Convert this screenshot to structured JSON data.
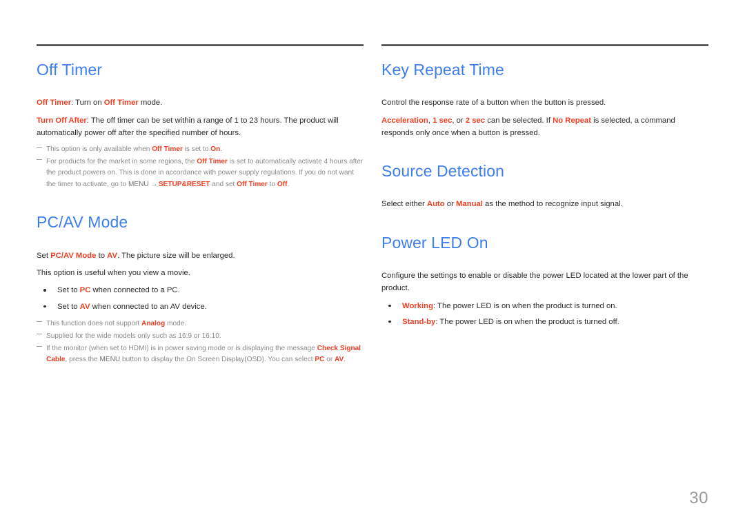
{
  "page": {
    "number": "30",
    "background_color": "#ffffff",
    "heading_color": "#3d7eed",
    "highlight_color": "#ef3e23",
    "body_color": "#2b2b2b",
    "note_color": "#8a8a8a",
    "rule_color": "#555555"
  },
  "left_column": {
    "sections": [
      {
        "title": "Off Timer",
        "paragraphs": [
          {
            "parts": [
              {
                "text": "Off Timer",
                "style": "highlight"
              },
              {
                "text": ": Turn on ",
                "style": "plain"
              },
              {
                "text": "Off Timer",
                "style": "highlight"
              },
              {
                "text": " mode.",
                "style": "plain"
              }
            ]
          },
          {
            "parts": [
              {
                "text": "Turn Off After",
                "style": "highlight"
              },
              {
                "text": ": The off timer can be set within a range of 1 to 23 hours. The product will automatically power off after the specified number of hours.",
                "style": "plain"
              }
            ]
          }
        ],
        "bullets": [],
        "notes": [
          {
            "parts": [
              {
                "text": "This option is only available when ",
                "style": "plain"
              },
              {
                "text": "Off Timer",
                "style": "highlight"
              },
              {
                "text": " is set to ",
                "style": "plain"
              },
              {
                "text": "On",
                "style": "highlight"
              },
              {
                "text": ".",
                "style": "plain"
              }
            ]
          },
          {
            "parts": [
              {
                "text": "For products for the market in some regions, the ",
                "style": "plain"
              },
              {
                "text": "Off Timer",
                "style": "highlight"
              },
              {
                "text": " is set to automatically activate 4 hours after the product powers on. This is done in accordance with power supply regulations. If you do not want the timer to activate, go to ",
                "style": "plain"
              },
              {
                "text": "MENU",
                "style": "caps"
              },
              {
                "text": " → ",
                "style": "arrow"
              },
              {
                "text": "SETUP&RESET",
                "style": "highlight"
              },
              {
                "text": " and set ",
                "style": "plain"
              },
              {
                "text": "Off Timer",
                "style": "highlight"
              },
              {
                "text": " to ",
                "style": "plain"
              },
              {
                "text": "Off",
                "style": "highlight"
              },
              {
                "text": ".",
                "style": "plain"
              }
            ]
          }
        ]
      },
      {
        "title": "PC/AV Mode",
        "paragraphs": [
          {
            "parts": [
              {
                "text": "Set ",
                "style": "plain"
              },
              {
                "text": "PC/AV Mode",
                "style": "highlight"
              },
              {
                "text": " to ",
                "style": "plain"
              },
              {
                "text": "AV",
                "style": "highlight"
              },
              {
                "text": ". The picture size will be enlarged.",
                "style": "plain"
              }
            ]
          },
          {
            "parts": [
              {
                "text": "This option is useful when you view a movie.",
                "style": "plain"
              }
            ]
          }
        ],
        "bullets": [
          {
            "parts": [
              {
                "text": "Set to ",
                "style": "plain"
              },
              {
                "text": "PC",
                "style": "highlight"
              },
              {
                "text": " when connected to a PC.",
                "style": "plain"
              }
            ]
          },
          {
            "parts": [
              {
                "text": "Set to ",
                "style": "plain"
              },
              {
                "text": "AV",
                "style": "highlight"
              },
              {
                "text": " when connected to an AV device.",
                "style": "plain"
              }
            ]
          }
        ],
        "notes": [
          {
            "parts": [
              {
                "text": "This function does not support ",
                "style": "plain"
              },
              {
                "text": "Analog",
                "style": "highlight"
              },
              {
                "text": " mode.",
                "style": "plain"
              }
            ]
          },
          {
            "parts": [
              {
                "text": "Supplied for the wide models only such as 16:9 or 16:10.",
                "style": "plain"
              }
            ]
          },
          {
            "parts": [
              {
                "text": "If the monitor (when set to HDMI) is in power saving mode or is displaying the message ",
                "style": "plain"
              },
              {
                "text": "Check Signal Cable",
                "style": "highlight"
              },
              {
                "text": ", press the ",
                "style": "plain"
              },
              {
                "text": "MENU",
                "style": "caps"
              },
              {
                "text": " button to display the On Screen Display(OSD). You can select ",
                "style": "plain"
              },
              {
                "text": "PC",
                "style": "highlight"
              },
              {
                "text": " or ",
                "style": "plain"
              },
              {
                "text": "AV",
                "style": "highlight"
              },
              {
                "text": ".",
                "style": "plain"
              }
            ]
          }
        ]
      }
    ]
  },
  "right_column": {
    "sections": [
      {
        "title": "Key Repeat Time",
        "paragraphs": [
          {
            "parts": [
              {
                "text": "Control the response rate of a button when the button is pressed.",
                "style": "plain"
              }
            ]
          },
          {
            "parts": [
              {
                "text": "Acceleration",
                "style": "highlight"
              },
              {
                "text": ", ",
                "style": "plain"
              },
              {
                "text": "1 sec",
                "style": "highlight"
              },
              {
                "text": ", or ",
                "style": "plain"
              },
              {
                "text": "2 sec",
                "style": "highlight"
              },
              {
                "text": " can be selected. If ",
                "style": "plain"
              },
              {
                "text": "No Repeat",
                "style": "highlight"
              },
              {
                "text": " is selected, a command responds only once when a button is pressed.",
                "style": "plain"
              }
            ]
          }
        ],
        "bullets": [],
        "notes": []
      },
      {
        "title": "Source Detection",
        "paragraphs": [
          {
            "parts": [
              {
                "text": "Select either ",
                "style": "plain"
              },
              {
                "text": "Auto",
                "style": "highlight"
              },
              {
                "text": " or ",
                "style": "plain"
              },
              {
                "text": "Manual",
                "style": "highlight"
              },
              {
                "text": " as the method to recognize input signal.",
                "style": "plain"
              }
            ]
          }
        ],
        "bullets": [],
        "notes": []
      },
      {
        "title": "Power LED On",
        "paragraphs": [
          {
            "parts": [
              {
                "text": "Configure the settings to enable or disable the power LED located at the lower part of the product.",
                "style": "plain"
              }
            ]
          }
        ],
        "bullets": [
          {
            "parts": [
              {
                "text": "Working",
                "style": "highlight"
              },
              {
                "text": ": The power LED is on when the product is turned on.",
                "style": "plain"
              }
            ]
          },
          {
            "parts": [
              {
                "text": "Stand-by",
                "style": "highlight"
              },
              {
                "text": ": The power LED is on when the product is turned off.",
                "style": "plain"
              }
            ]
          }
        ],
        "notes": []
      }
    ]
  }
}
